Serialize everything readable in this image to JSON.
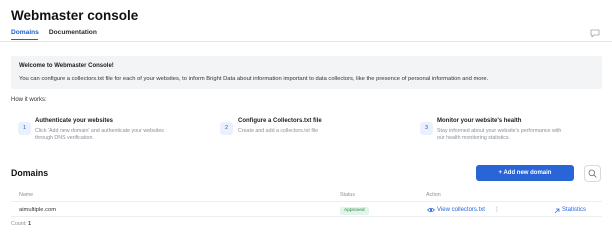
{
  "app": {
    "title": "Webmaster console"
  },
  "tabs": [
    {
      "label": "Domains",
      "active": true
    },
    {
      "label": "Documentation",
      "active": false
    }
  ],
  "banner": {
    "title": "Welcome to Webmaster Console!",
    "text": "You can configure a collectors.txt file for each of your websites, to inform Bright Data about information important to data collectors, like the presence of personal information and more."
  },
  "how_it_works": {
    "label": "How it works:",
    "steps": [
      {
        "num": "1",
        "title": "Authenticate your websites",
        "desc_line1": "Click 'Add new domain' and authenticate your websites",
        "desc_line2": "through DNS verification."
      },
      {
        "num": "2",
        "title": "Configure a Collectors.txt file",
        "desc_line1": "Create and add a collectors.txt file",
        "desc_line2": ""
      },
      {
        "num": "3",
        "title": "Monitor your website's health",
        "desc_line1": "Stay informed about your website's performance with",
        "desc_line2": "our health monitoring statistics."
      }
    ]
  },
  "domains": {
    "title": "Domains",
    "add_button": "+ Add new domain",
    "columns": {
      "name": "Name",
      "status": "Status",
      "action": "Action"
    },
    "rows": [
      {
        "name": "aimultiple.com",
        "status": "Approved",
        "action": "View collectors.txt",
        "stats": "Statistics"
      }
    ],
    "count_label": "Count:",
    "count_value": "1"
  },
  "colors": {
    "accent": "#2965d6",
    "approved_bg": "#e3f5e8",
    "approved_text": "#1f8a43",
    "banner_bg": "#f2f4f6"
  },
  "icons": {
    "feedback": "chat-bubble-icon",
    "search": "search-icon",
    "view": "eye-icon",
    "more": "kebab-icon",
    "stats": "arrow-up-right-icon"
  }
}
